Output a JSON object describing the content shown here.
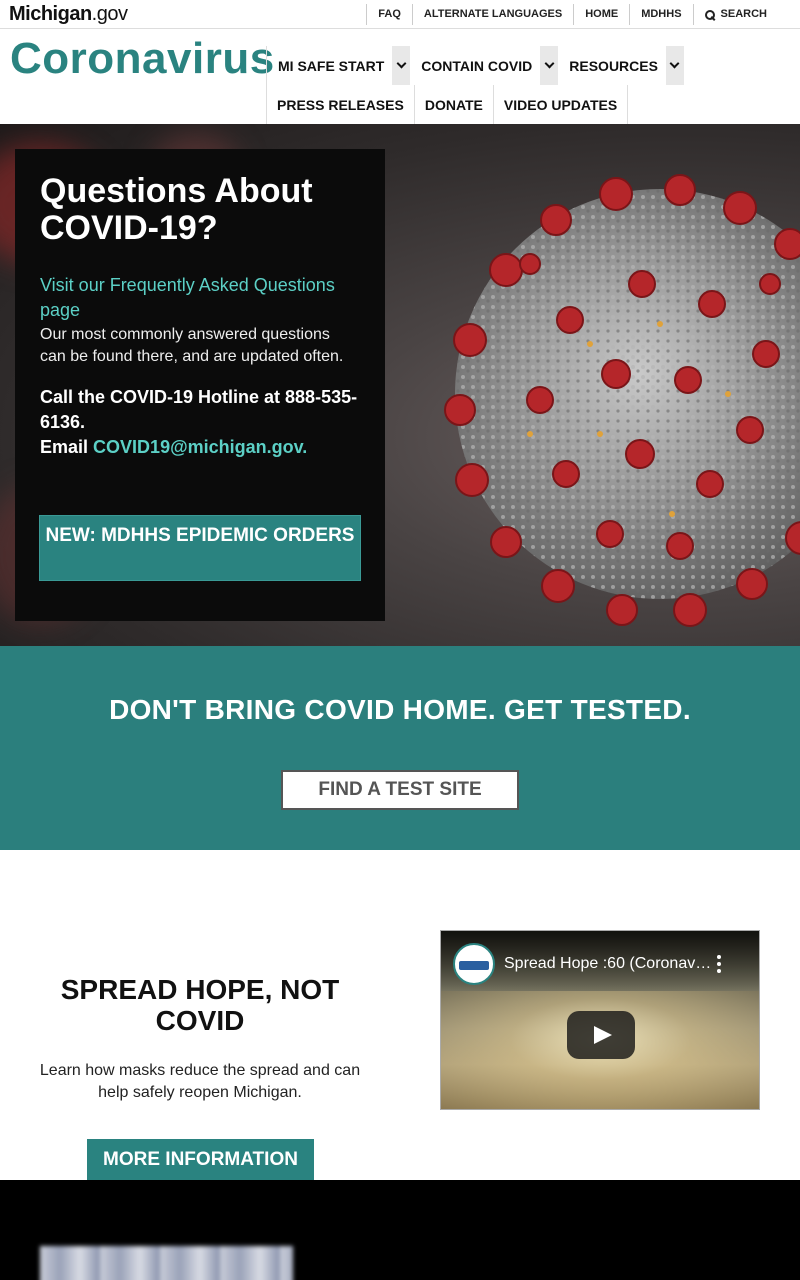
{
  "topbar": {
    "logo_bold": "Michigan",
    "logo_light": ".gov",
    "links": [
      "FAQ",
      "ALTERNATE LANGUAGES",
      "HOME",
      "MDHHS"
    ],
    "search_label": "SEARCH"
  },
  "header": {
    "site_title": "Coronavirus",
    "nav_primary": [
      "MI SAFE START",
      "CONTAIN COVID",
      "RESOURCES"
    ],
    "nav_secondary": [
      "PRESS RELEASES",
      "DONATE",
      "VIDEO UPDATES"
    ]
  },
  "hero": {
    "title": "Questions About COVID-19?",
    "faq_link": "Visit our Frequently Asked Questions page",
    "faq_text": "Our most commonly answered questions can be found there, and are updated often.",
    "hotline": "Call the COVID-19 Hotline at 888-535-6136.",
    "email_prefix": "Email",
    "email": "COVID19@michigan.gov.",
    "button": "NEW: MDHHS EPIDEMIC ORDERS"
  },
  "testing": {
    "headline": "DON'T BRING COVID HOME. GET TESTED.",
    "button": "FIND A TEST SITE"
  },
  "hope": {
    "headline": "SPREAD HOPE, NOT COVID",
    "text": "Learn how masks reduce the spread and can help safely reopen Michigan.",
    "button": "MORE INFORMATION",
    "video_title": "Spread Hope :60 (Coronavirus)"
  },
  "colors": {
    "teal": "#2a8380",
    "link_teal": "#5cd0c6"
  }
}
